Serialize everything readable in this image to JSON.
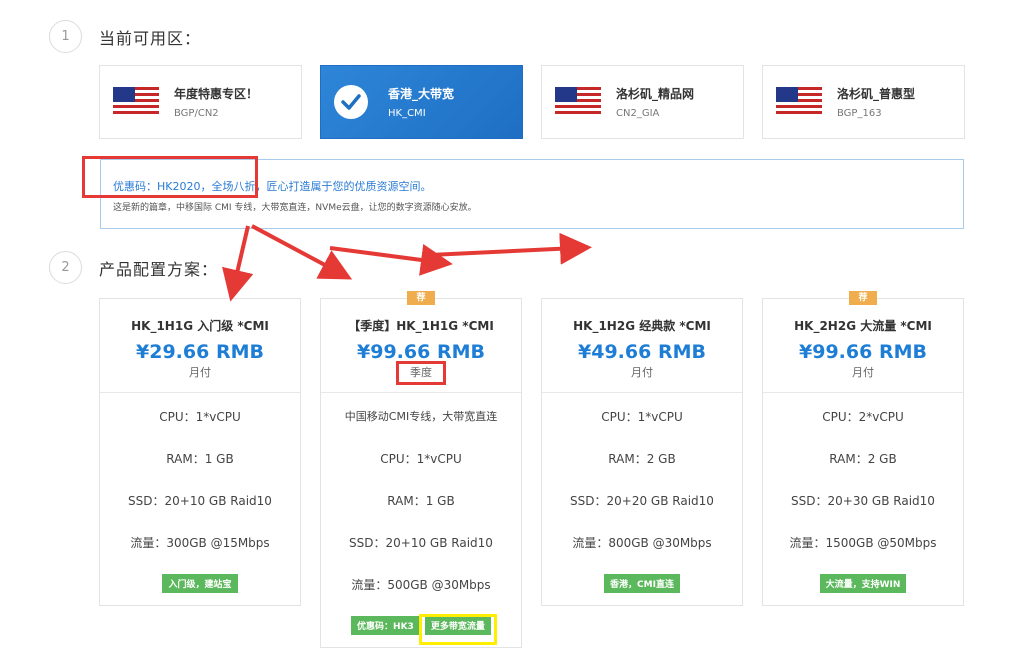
{
  "steps": [
    {
      "num": "1",
      "title": "当前可用区："
    },
    {
      "num": "2",
      "title": "产品配置方案："
    }
  ],
  "regions": [
    {
      "title": "年度特惠专区！",
      "sub": "BGP/CN2",
      "icon": "us-flag-icon",
      "selected": false
    },
    {
      "title": "香港_大带宽",
      "sub": "HK_CMI",
      "icon": "check-icon",
      "selected": true
    },
    {
      "title": "洛杉矶_精品网",
      "sub": "CN2_GIA",
      "icon": "us-flag-icon",
      "selected": false
    },
    {
      "title": "洛杉矶_普惠型",
      "sub": "BGP_163",
      "icon": "us-flag-icon",
      "selected": false
    }
  ],
  "notice": {
    "line1": "优惠码：HK2020，全场八折，匠心打造属于您的优质资源空间。",
    "line2": "这是新的篇章，中移国际 CMI 专线，大带宽直连，NVMe云盘，让您的数字资源随心安放。"
  },
  "plans": [
    {
      "name": "HK_1H1G 入门级 *CMI",
      "price": "¥29.66 RMB",
      "period": "月付",
      "recommend": "",
      "specs": [
        "CPU：1*vCPU",
        "RAM：1 GB",
        "SSD：20+10 GB Raid10",
        "流量：300GB @15Mbps"
      ],
      "tags": [
        "入门级，建站宝"
      ]
    },
    {
      "name": "【季度】HK_1H1G *CMI",
      "price": "¥99.66 RMB",
      "period": "季度",
      "recommend": "荐",
      "specs": [
        "中国移动CMI专线，大带宽直连",
        "CPU：1*vCPU",
        "RAM：1 GB",
        "SSD：20+10 GB Raid10",
        "流量：500GB @30Mbps"
      ],
      "tags": [
        "优惠码：HK3",
        "更多带宽流量"
      ]
    },
    {
      "name": "HK_1H2G 经典款 *CMI",
      "price": "¥49.66 RMB",
      "period": "月付",
      "recommend": "",
      "specs": [
        "CPU：1*vCPU",
        "RAM：2 GB",
        "SSD：20+20 GB Raid10",
        "流量：800GB @30Mbps"
      ],
      "tags": [
        "香港，CMI直连"
      ]
    },
    {
      "name": "HK_2H2G 大流量 *CMI",
      "price": "¥99.66 RMB",
      "period": "月付",
      "recommend": "荐",
      "specs": [
        "CPU：2*vCPU",
        "RAM：2 GB",
        "SSD：20+30 GB Raid10",
        "流量：1500GB @50Mbps"
      ],
      "tags": [
        "大流量，支持WIN"
      ]
    }
  ],
  "colors": {
    "accent": "#1e7ed6",
    "selected_bg": "#2683d6",
    "tag_green": "#5cb85c",
    "recommend_orange": "#f0ad4e",
    "annotation_red": "#e53935",
    "annotation_yellow": "#ffee00"
  }
}
